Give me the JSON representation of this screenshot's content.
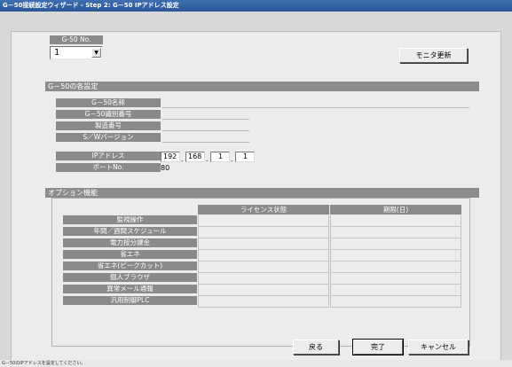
{
  "window": {
    "title": "G－50接続設定ウィザード - Step 2: G－50 IPアドレス設定"
  },
  "selector": {
    "label": "G-50 No.",
    "value": "1"
  },
  "toolbar": {
    "monitor_refresh": "モニタ更新"
  },
  "settings": {
    "section_title": "G－50の各設定",
    "fields": [
      {
        "label": "G－50名称",
        "value": ""
      },
      {
        "label": "G－50識別番号",
        "value": ""
      },
      {
        "label": "製造番号",
        "value": ""
      },
      {
        "label": "S／Wバージョン",
        "value": ""
      }
    ],
    "ip_label": "IPアドレス",
    "ip": [
      "192",
      "168",
      "1",
      "1"
    ],
    "port_label": "ポートNo.",
    "port": "80"
  },
  "options": {
    "section_title": "オプション機能",
    "columns": [
      "ライセンス状態",
      "期限(日)"
    ],
    "rows": [
      "監視操作",
      "年間／週間スケジュール",
      "電力按分課金",
      "省エネ",
      "省エネ(ピークカット)",
      "個人ブラウザ",
      "異常メール通報",
      "汎用制御PLC"
    ]
  },
  "footer": {
    "back": "戻る",
    "finish": "完了",
    "cancel": "キャンセル"
  },
  "status": {
    "text": "G－50のIPアドレスを設定してください。"
  }
}
